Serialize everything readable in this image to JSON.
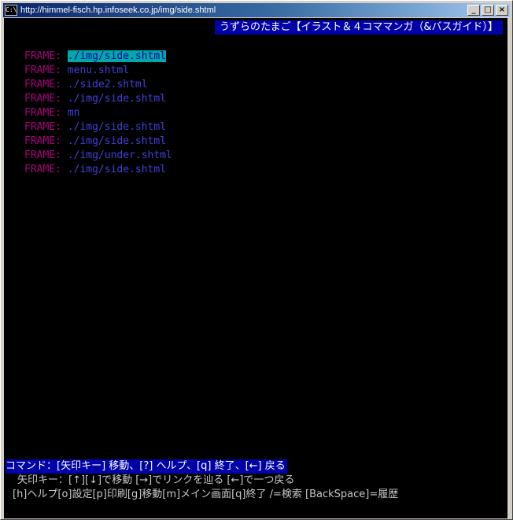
{
  "window": {
    "title": "http://himmel-fisch.hp.infoseek.co.jp/img/side.shtml",
    "icon_text": "C:\\",
    "controls": {
      "minimize": "_",
      "maximize": "□",
      "close": "×"
    }
  },
  "page": {
    "header": "うずらのたまご【イラスト＆４コママンガ（&バスガイド）】"
  },
  "frames": [
    {
      "label": "FRAME:",
      "link": "./img/side.shtml",
      "selected": true
    },
    {
      "label": "FRAME:",
      "link": "menu.shtml"
    },
    {
      "label": "FRAME:",
      "link": "./side2.shtml"
    },
    {
      "label": "FRAME:",
      "link": "./img/side.shtml"
    },
    {
      "label": "FRAME:",
      "link": "mn"
    },
    {
      "label": "FRAME:",
      "link": "./img/side.shtml"
    },
    {
      "label": "FRAME:",
      "link": "./img/side.shtml"
    },
    {
      "label": "FRAME:",
      "link": "./img/under.shtml"
    },
    {
      "label": "FRAME:",
      "link": "./img/side.shtml"
    }
  ],
  "status": {
    "command": "コマンド：[矢印キー] 移動、[?] ヘルプ、[q] 終了、[←] 戻る",
    "arrows": "矢印キー：[↑][↓]で移動 [→]でリンクを辿る [←]で一つ戻る",
    "keys": "[h]ヘルプ[o]設定[p]印刷[g]移動[m]メイン画面[q]終了 /=検索 [BackSpace]=履歴"
  },
  "colors": {
    "background": "#000000",
    "frame_label": "#a8007c",
    "frame_link": "#4040d8",
    "selected_bg": "#00a8a8",
    "header_bg": "#0000a8",
    "status_text": "#c8c8c8"
  }
}
